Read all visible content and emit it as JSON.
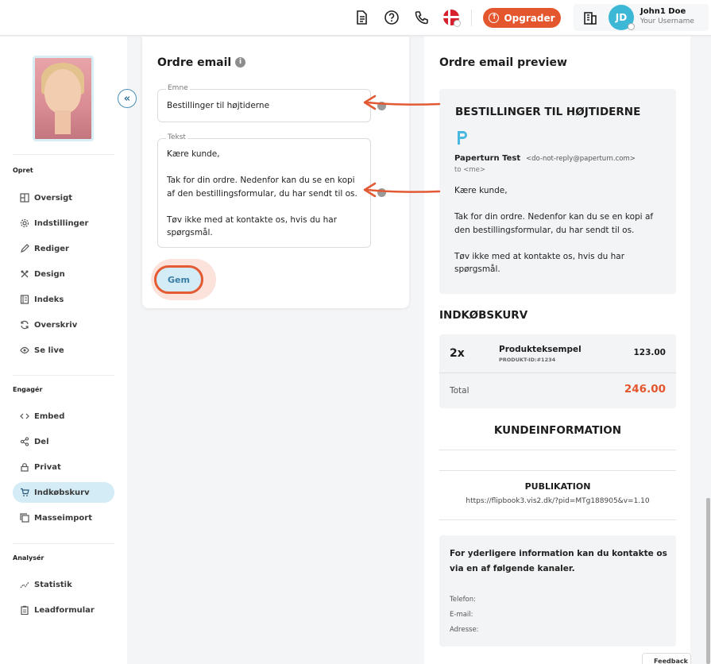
{
  "topbar": {
    "upgrade_label": "Opgrader",
    "user_name": "John1 Doe",
    "user_sub": "Your Username",
    "avatar_initials": "JD",
    "accent_color": "#e4572e",
    "avatar_color": "#3cb8d6"
  },
  "sidebar": {
    "section_create": "Opret",
    "section_engage": "Engagér",
    "section_analyze": "Analysér",
    "items_create": [
      "Oversigt",
      "Indstillinger",
      "Rediger",
      "Design",
      "Indeks",
      "Overskriv",
      "Se live"
    ],
    "items_engage": [
      "Embed",
      "Del",
      "Privat",
      "Indkøbskurv",
      "Masseimport"
    ],
    "items_analyze": [
      "Statistik",
      "Leadformular"
    ],
    "active_item": "Indkøbskurv"
  },
  "form": {
    "title": "Ordre email",
    "subject_label": "Emne",
    "subject_value": "Bestillinger til højtiderne",
    "text_label": "Tekst",
    "text_value": "Kære kunde,\n\nTak for din ordre. Nedenfor kan du se en kopi\naf den bestillingsformular, du har sendt til os.\n\nTøv ikke med at kontakte os, hvis du har\nspørgsmål.",
    "save_label": "Gem"
  },
  "preview": {
    "title": "Ordre email preview",
    "heading": "BESTILLINGER TIL HØJTIDERNE",
    "sender_name": "Paperturn Test",
    "sender_address": "<do-not-reply@paperturn.com>",
    "to_line": "to <me>",
    "body": "Kære kunde,\n\nTak for din ordre. Nedenfor kan du se en kopi af\nden bestillingsformular, du har sendt til os.\n\nTøv ikke med at kontakte os, hvis du har\nspørgsmål.",
    "cart": {
      "title": "INDKØBSKURV",
      "qty": "2x",
      "product": "Produkteksempel",
      "product_id": "PRODUKT-ID:#1234",
      "price": "123.00",
      "total_label": "Total",
      "total_value": "246.00"
    },
    "customer_title": "KUNDEINFORMATION",
    "publication_title": "PUBLIKATION",
    "publication_url": "https://flipbook3.vis2.dk/?pid=MTg188905&v=1.10",
    "contact_text": "For yderligere information kan du kontakte os via en af følgende kanaler.",
    "contact_phone": "Telefon:",
    "contact_email": "E-mail:",
    "contact_address": "Adresse:"
  },
  "feedback_label": "Feedback"
}
